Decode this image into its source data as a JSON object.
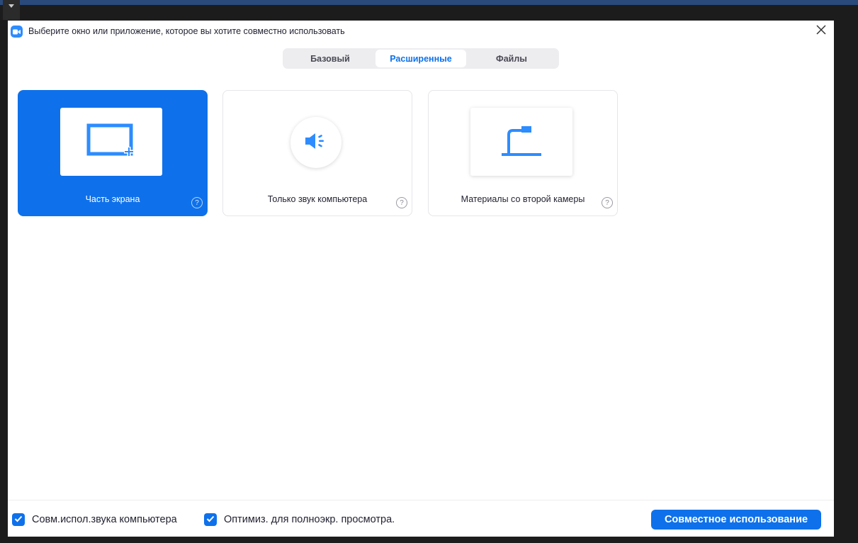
{
  "window": {
    "title": "Выберите окно или приложение, которое вы хотите совместно использовать"
  },
  "icons": {
    "app_logo": "zoom-camera-icon",
    "close": "close-icon",
    "dropdown": "caret-down-icon",
    "portion": "screen-portion-icon",
    "sound": "speaker-icon",
    "camera": "document-camera-icon",
    "help": "question-icon",
    "check": "checkmark-icon"
  },
  "tabs": [
    {
      "label": "Базовый",
      "active": false
    },
    {
      "label": "Расширенные",
      "active": true
    },
    {
      "label": "Файлы",
      "active": false
    }
  ],
  "options": [
    {
      "label": "Часть экрана",
      "selected": true
    },
    {
      "label": "Только звук компьютера",
      "selected": false
    },
    {
      "label": "Материалы со второй камеры",
      "selected": false
    }
  ],
  "help_glyph": "?",
  "footer": {
    "checkboxes": [
      {
        "label": "Совм.испол.звука компьютера",
        "checked": true
      },
      {
        "label": "Оптимиз. для полноэкр. просмотра.",
        "checked": true
      }
    ],
    "share_button": "Совместное использование"
  },
  "colors": {
    "accent": "#0e71eb",
    "icon_blue": "#2d8cff",
    "background": "#ffffff",
    "top_strip": "#2a4a7c"
  }
}
